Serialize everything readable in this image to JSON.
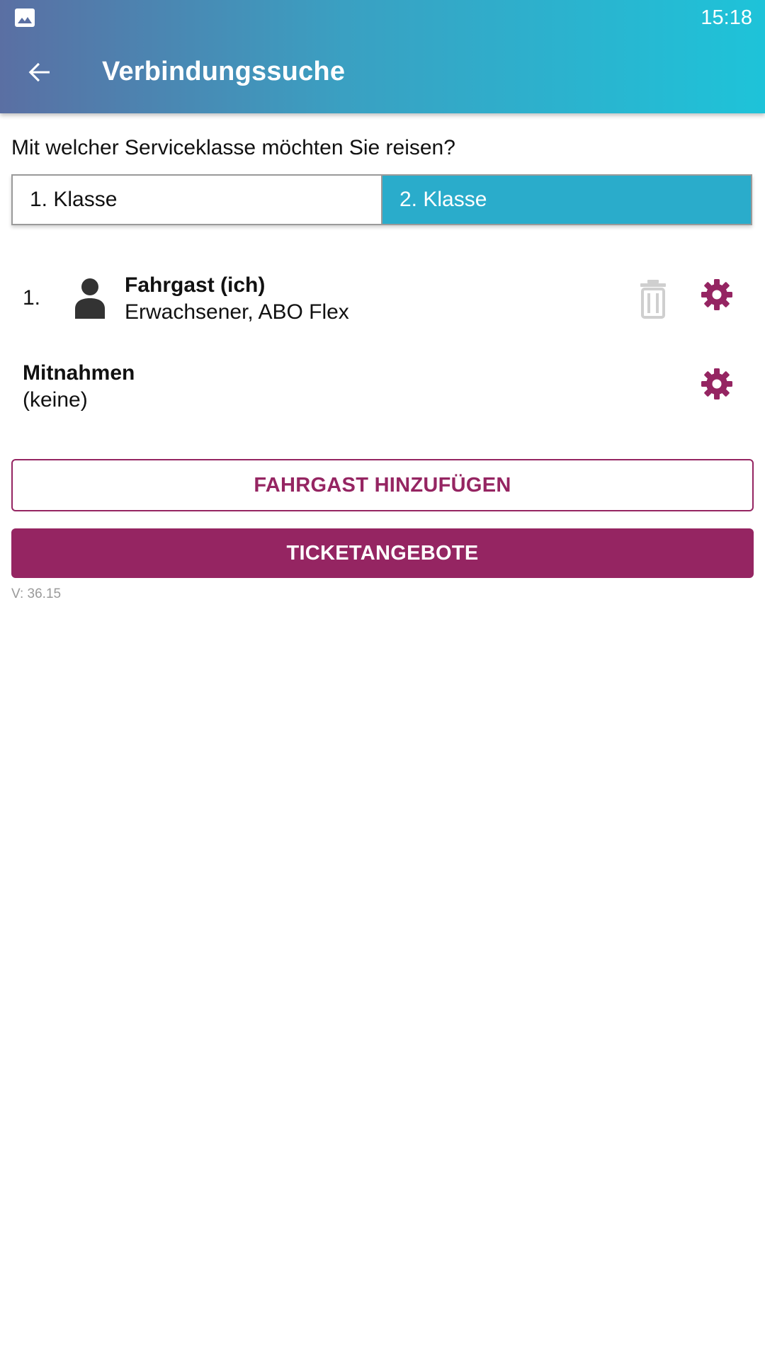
{
  "status_bar": {
    "time": "15:18",
    "notification_icon": "image-icon"
  },
  "app_bar": {
    "title": "Verbindungssuche",
    "back_icon": "arrow-back-icon"
  },
  "service_class": {
    "question": "Mit welcher Serviceklasse möchten Sie reisen?",
    "options": [
      "1. Klasse",
      "2. Klasse"
    ],
    "selected": "2. Klasse"
  },
  "passengers": [
    {
      "index": "1.",
      "name": "Fahrgast (ich)",
      "detail": "Erwachsener, ABO Flex",
      "icon": "person-icon"
    }
  ],
  "mitnahmen": {
    "title": "Mitnahmen",
    "value": "(keine)"
  },
  "buttons": {
    "add_passenger": "FAHRGAST HINZUFÜGEN",
    "ticket_offers": "TICKETANGEBOTE"
  },
  "version": "V: 36.15",
  "colors": {
    "accent": "#952562",
    "selected_segment": "#2aaccb",
    "header_gradient_start": "#5a6fa3",
    "header_gradient_end": "#1ec3d9"
  }
}
